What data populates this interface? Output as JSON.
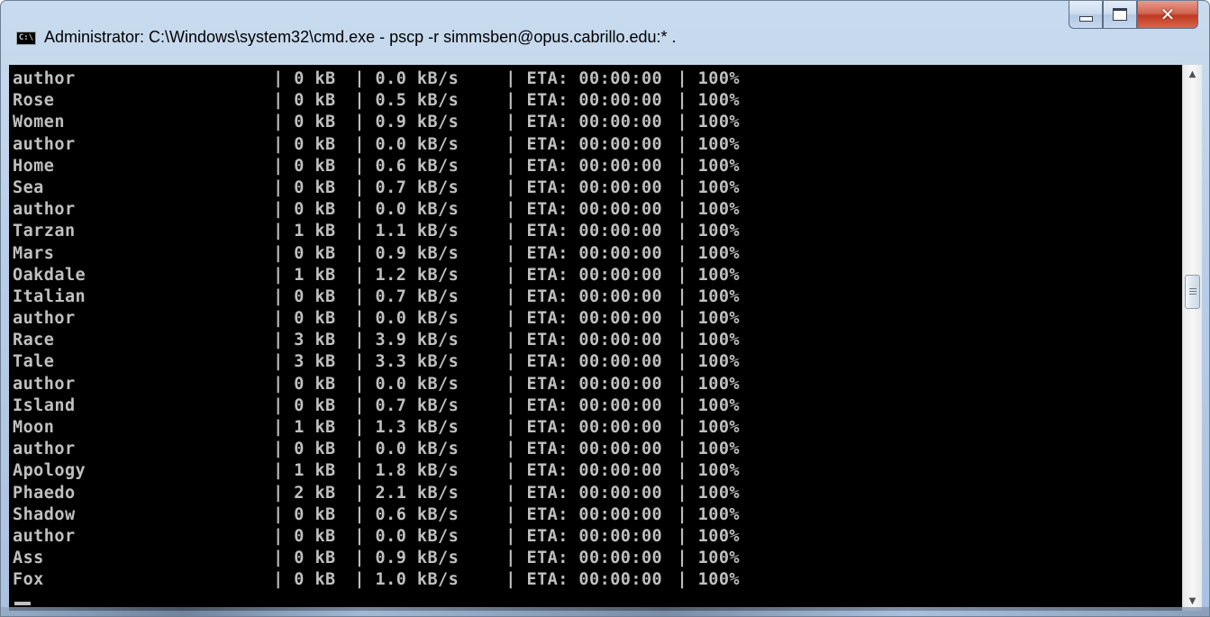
{
  "window": {
    "title": "Administrator: C:\\Windows\\system32\\cmd.exe - pscp  -r simmsben@opus.cabrillo.edu:* .",
    "icon_label": "C:\\",
    "controls": {
      "minimize": "minimize",
      "maximize": "maximize",
      "close": "✕"
    }
  },
  "console": {
    "colors": {
      "background": "#000000",
      "text": "#c0c0c0"
    },
    "rows": [
      {
        "name": "author",
        "size": "0 kB",
        "rate": "0.0 kB/s",
        "eta": "ETA: 00:00:00",
        "pct": "100%"
      },
      {
        "name": "Rose",
        "size": "0 kB",
        "rate": "0.5 kB/s",
        "eta": "ETA: 00:00:00",
        "pct": "100%"
      },
      {
        "name": "Women",
        "size": "0 kB",
        "rate": "0.9 kB/s",
        "eta": "ETA: 00:00:00",
        "pct": "100%"
      },
      {
        "name": "author",
        "size": "0 kB",
        "rate": "0.0 kB/s",
        "eta": "ETA: 00:00:00",
        "pct": "100%"
      },
      {
        "name": "Home",
        "size": "0 kB",
        "rate": "0.6 kB/s",
        "eta": "ETA: 00:00:00",
        "pct": "100%"
      },
      {
        "name": "Sea",
        "size": "0 kB",
        "rate": "0.7 kB/s",
        "eta": "ETA: 00:00:00",
        "pct": "100%"
      },
      {
        "name": "author",
        "size": "0 kB",
        "rate": "0.0 kB/s",
        "eta": "ETA: 00:00:00",
        "pct": "100%"
      },
      {
        "name": "Tarzan",
        "size": "1 kB",
        "rate": "1.1 kB/s",
        "eta": "ETA: 00:00:00",
        "pct": "100%"
      },
      {
        "name": "Mars",
        "size": "0 kB",
        "rate": "0.9 kB/s",
        "eta": "ETA: 00:00:00",
        "pct": "100%"
      },
      {
        "name": "Oakdale",
        "size": "1 kB",
        "rate": "1.2 kB/s",
        "eta": "ETA: 00:00:00",
        "pct": "100%"
      },
      {
        "name": "Italian",
        "size": "0 kB",
        "rate": "0.7 kB/s",
        "eta": "ETA: 00:00:00",
        "pct": "100%"
      },
      {
        "name": "author",
        "size": "0 kB",
        "rate": "0.0 kB/s",
        "eta": "ETA: 00:00:00",
        "pct": "100%"
      },
      {
        "name": "Race",
        "size": "3 kB",
        "rate": "3.9 kB/s",
        "eta": "ETA: 00:00:00",
        "pct": "100%"
      },
      {
        "name": "Tale",
        "size": "3 kB",
        "rate": "3.3 kB/s",
        "eta": "ETA: 00:00:00",
        "pct": "100%"
      },
      {
        "name": "author",
        "size": "0 kB",
        "rate": "0.0 kB/s",
        "eta": "ETA: 00:00:00",
        "pct": "100%"
      },
      {
        "name": "Island",
        "size": "0 kB",
        "rate": "0.7 kB/s",
        "eta": "ETA: 00:00:00",
        "pct": "100%"
      },
      {
        "name": "Moon",
        "size": "1 kB",
        "rate": "1.3 kB/s",
        "eta": "ETA: 00:00:00",
        "pct": "100%"
      },
      {
        "name": "author",
        "size": "0 kB",
        "rate": "0.0 kB/s",
        "eta": "ETA: 00:00:00",
        "pct": "100%"
      },
      {
        "name": "Apology",
        "size": "1 kB",
        "rate": "1.8 kB/s",
        "eta": "ETA: 00:00:00",
        "pct": "100%"
      },
      {
        "name": "Phaedo",
        "size": "2 kB",
        "rate": "2.1 kB/s",
        "eta": "ETA: 00:00:00",
        "pct": "100%"
      },
      {
        "name": "Shadow",
        "size": "0 kB",
        "rate": "0.6 kB/s",
        "eta": "ETA: 00:00:00",
        "pct": "100%"
      },
      {
        "name": "author",
        "size": "0 kB",
        "rate": "0.0 kB/s",
        "eta": "ETA: 00:00:00",
        "pct": "100%"
      },
      {
        "name": "Ass",
        "size": "0 kB",
        "rate": "0.9 kB/s",
        "eta": "ETA: 00:00:00",
        "pct": "100%"
      },
      {
        "name": "Fox",
        "size": "0 kB",
        "rate": "1.0 kB/s",
        "eta": "ETA: 00:00:00",
        "pct": "100%"
      }
    ]
  },
  "scrollbar": {
    "up_icon": "▲",
    "down_icon": "▼"
  }
}
